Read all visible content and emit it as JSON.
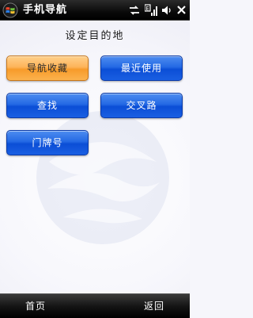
{
  "statusbar": {
    "app_title": "手机导航",
    "icons": [
      "windows-start-icon",
      "connectivity-icon",
      "signal-icon",
      "volume-icon",
      "close-icon"
    ]
  },
  "main": {
    "title": "设定目的地",
    "buttons": [
      {
        "label": "导航收藏",
        "selected": true
      },
      {
        "label": "最近使用",
        "selected": false
      },
      {
        "label": "查找",
        "selected": false
      },
      {
        "label": "交叉路",
        "selected": false
      },
      {
        "label": "门牌号",
        "selected": false
      }
    ]
  },
  "softkeys": {
    "left": "首页",
    "right": "返回"
  },
  "colors": {
    "button_blue": "#1a5fe2",
    "button_selected_orange": "#f79b2a",
    "bar_black": "#000000"
  }
}
